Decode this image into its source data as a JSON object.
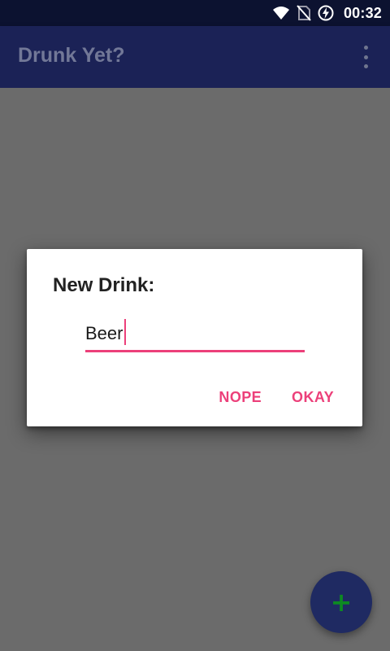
{
  "status_bar": {
    "time": "00:32",
    "icons": [
      "wifi-icon",
      "no-sim-icon",
      "battery-charging-icon"
    ]
  },
  "app_bar": {
    "title": "Drunk Yet?",
    "menu_icon": "overflow-menu-icon"
  },
  "dialog": {
    "title": "New Drink:",
    "input": {
      "value": "Beer"
    },
    "buttons": {
      "cancel": "NOPE",
      "ok": "OKAY"
    }
  },
  "fab": {
    "icon": "plus-icon",
    "label": "+"
  },
  "colors": {
    "status_bar": "#0c1230",
    "app_bar": "#1b2256",
    "accent": "#ec407a",
    "fab": "#1f2a62",
    "fab_icon": "#0d8a22",
    "scrim": "#6b6b6b"
  }
}
